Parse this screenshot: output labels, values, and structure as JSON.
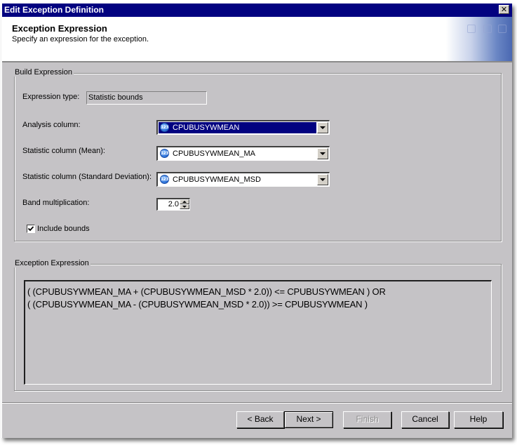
{
  "window": {
    "title": "Edit Exception Definition",
    "close_icon": "close-icon"
  },
  "header": {
    "title": "Exception Expression",
    "subtitle": "Specify an expression for the exception."
  },
  "build_group": {
    "legend": "Build Expression",
    "expression_type": {
      "label": "Expression type:",
      "value": "Statistic bounds"
    },
    "analysis_column": {
      "label": "Analysis column:",
      "value": "CPUBUSYWMEAN",
      "icon": "numeric-column-icon",
      "icon_text": "123"
    },
    "stat_mean": {
      "label": "Statistic column (Mean):",
      "value": "CPUBUSYWMEAN_MA",
      "icon": "numeric-column-icon",
      "icon_text": "123"
    },
    "stat_sd": {
      "label": "Statistic column (Standard Deviation):",
      "value": "CPUBUSYWMEAN_MSD",
      "icon": "numeric-column-icon",
      "icon_text": "123"
    },
    "band_multiplication": {
      "label": "Band multiplication:",
      "value": "2.0"
    },
    "include_bounds": {
      "label": "Include bounds",
      "checked": true
    }
  },
  "expression_group": {
    "legend": "Exception Expression",
    "lines": [
      "( (CPUBUSYWMEAN_MA + (CPUBUSYWMEAN_MSD * 2.0)) <= CPUBUSYWMEAN ) OR",
      "( (CPUBUSYWMEAN_MA - (CPUBUSYWMEAN_MSD * 2.0)) >= CPUBUSYWMEAN )"
    ]
  },
  "buttons": {
    "back": "< Back",
    "next": "Next >",
    "finish": "Finish",
    "cancel": "Cancel",
    "help": "Help"
  },
  "colors": {
    "titlebar": "#020280",
    "dialog_bg": "#c5c3c6",
    "selection": "#020280"
  }
}
